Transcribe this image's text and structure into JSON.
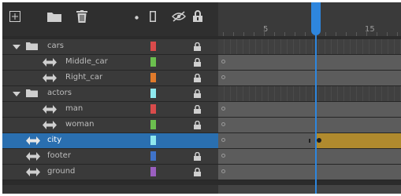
{
  "toolbar": {
    "icons": [
      "new-layer-icon",
      "new-folder-icon",
      "delete-layer-icon",
      "highlight-dot-icon",
      "outline-icon",
      "visibility-icon",
      "lock-icon"
    ]
  },
  "ruler": {
    "labels": [
      "5",
      "15"
    ],
    "playhead_frame": 9
  },
  "layers": [
    {
      "name": "cars",
      "type": "folder",
      "color": null,
      "locked": true
    },
    {
      "name": "Middle_car",
      "type": "symbol",
      "color": "#6bbf4e",
      "locked": true
    },
    {
      "name": "Right_car",
      "type": "symbol",
      "color": "#e07a2b",
      "locked": true
    },
    {
      "name": "actors",
      "type": "folder",
      "color": null,
      "locked": true
    },
    {
      "name": "man",
      "type": "symbol",
      "color": "#d94b4b",
      "locked": true
    },
    {
      "name": "woman",
      "type": "symbol",
      "color": "#6bbf4e",
      "locked": true
    },
    {
      "name": "city",
      "type": "symbol",
      "color": "#8ee8ee",
      "locked": false,
      "selected": true
    },
    {
      "name": "footer",
      "type": "symbol",
      "color": "#3f73c9",
      "locked": true
    },
    {
      "name": "ground",
      "type": "symbol",
      "color": "#9b5fc0",
      "locked": true
    }
  ],
  "colors": {
    "accent": "#2e86de",
    "selected_row": "#2a6fb0",
    "tween": "#b08a2e",
    "folder_cars_swatch": "#d94b4b",
    "folder_actors_swatch": "#8ee8ee"
  }
}
